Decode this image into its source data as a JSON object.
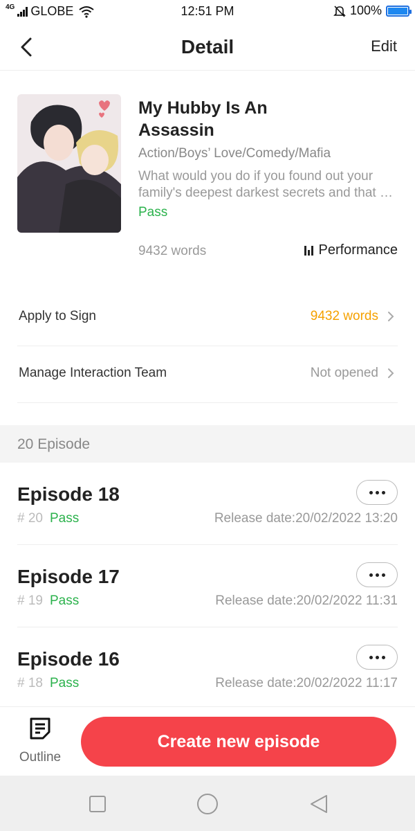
{
  "status_bar": {
    "network": "4G",
    "carrier": "GLOBE",
    "time": "12:51 PM",
    "battery": "100%",
    "battery_level": 1.0,
    "icons": [
      "signal-icon",
      "wifi-icon",
      "mute-bell-icon",
      "battery-icon"
    ]
  },
  "header": {
    "back_icon": "chevron-left-icon",
    "title": "Detail",
    "edit_label": "Edit"
  },
  "book": {
    "title_line1": "My Hubby Is An",
    "title_line2": "Assassin",
    "genres": "Action/Boys’ Love/Comedy/Mafia",
    "description_line1": "What would you do if you found out your",
    "description_line2": "family's deepest darkest secrets and that your",
    "status": "Pass",
    "words": "9432 words",
    "performance_label": "Performance",
    "performance_icon": "bar-chart-icon"
  },
  "settings_rows": [
    {
      "label": "Apply to Sign",
      "value": "9432 words",
      "value_color": "#f5a100"
    },
    {
      "label": "Manage Interaction Team",
      "value": "Not opened",
      "value_color": "#999999"
    }
  ],
  "episodes_section": {
    "label": "20 Episode"
  },
  "episodes": [
    {
      "title": "Episode 18",
      "number": "# 20",
      "status": "Pass",
      "release": "Release date:20/02/2022 13:20"
    },
    {
      "title": "Episode 17",
      "number": "# 19",
      "status": "Pass",
      "release": "Release date:20/02/2022 11:31"
    },
    {
      "title": "Episode 16",
      "number": "# 18",
      "status": "Pass",
      "release": "Release date:20/02/2022 11:17"
    }
  ],
  "action_bar": {
    "outline_label": "Outline",
    "outline_icon": "document-list-icon",
    "create_label": "Create new episode"
  },
  "colors": {
    "accent_red": "#f5434a",
    "pass_green": "#2bb24c",
    "highlight_orange": "#f5a100",
    "battery_blue": "#1e88f0"
  }
}
